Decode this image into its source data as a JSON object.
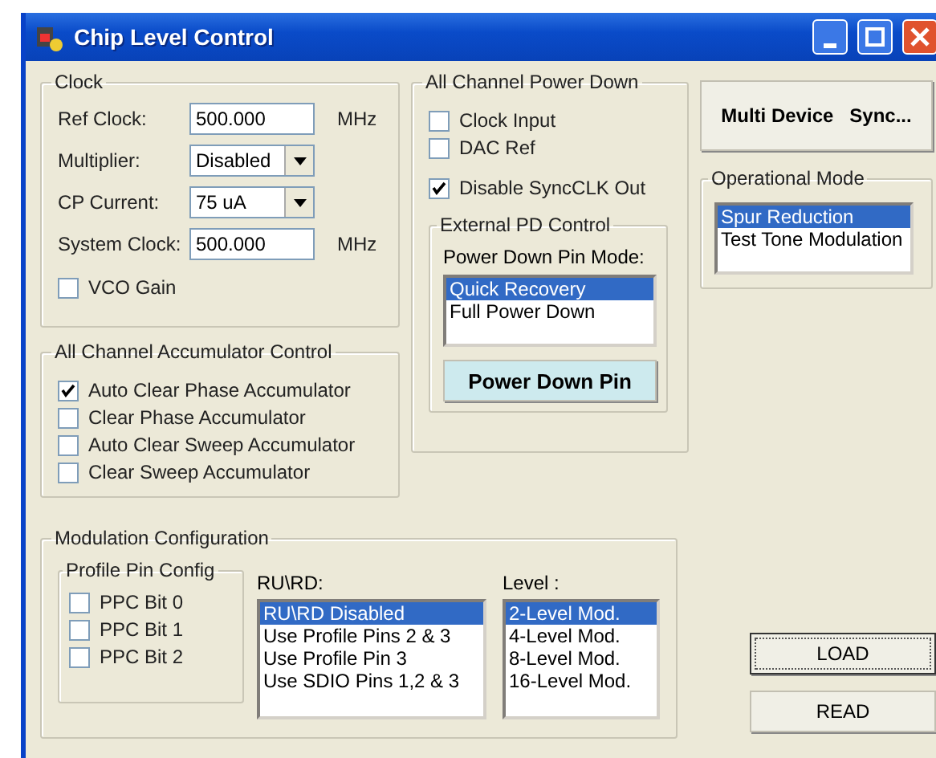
{
  "window": {
    "title": "Chip Level Control"
  },
  "clock": {
    "title": "Clock",
    "rows": [
      {
        "kind": "text",
        "label": "Ref Clock:",
        "value": "500.000",
        "unit": "MHz"
      },
      {
        "kind": "select",
        "label": "Multiplier:",
        "value": "Disabled"
      },
      {
        "kind": "select",
        "label": "CP Current:",
        "value": "75 uA"
      },
      {
        "kind": "text",
        "label": "System Clock:",
        "value": "500.000",
        "unit": "MHz"
      },
      {
        "kind": "check",
        "label": "VCO Gain",
        "checked": false
      }
    ]
  },
  "accumulator": {
    "title": "All Channel Accumulator Control",
    "options": [
      {
        "label": "Auto Clear Phase Accumulator",
        "checked": true
      },
      {
        "label": "Clear Phase Accumulator",
        "checked": false
      },
      {
        "label": "Auto Clear Sweep Accumulator",
        "checked": false
      },
      {
        "label": "Clear Sweep Accumulator",
        "checked": false
      }
    ]
  },
  "power_down": {
    "title": "All Channel Power Down",
    "options": [
      {
        "label": "Clock Input",
        "checked": false
      },
      {
        "label": "DAC Ref",
        "checked": false
      },
      {
        "label": "Disable SyncCLK Out",
        "checked": true
      }
    ],
    "external_pd": {
      "title": "External PD Control",
      "label": "Power Down Pin Mode:",
      "items": [
        {
          "label": "Quick Recovery",
          "selected": true
        },
        {
          "label": "Full Power Down",
          "selected": false
        }
      ],
      "button": "Power Down Pin"
    }
  },
  "multi_device_button": {
    "parts": [
      "Multi Device",
      "Sync..."
    ]
  },
  "operational_mode": {
    "title": "Operational Mode",
    "items": [
      {
        "label": "Spur Reduction",
        "selected": true
      },
      {
        "label": "Test Tone Modulation",
        "selected": false
      }
    ]
  },
  "modulation": {
    "title": "Modulation Configuration",
    "profile_pin_config": {
      "title": "Profile Pin Config",
      "options": [
        {
          "label": "PPC Bit 0",
          "checked": false
        },
        {
          "label": "PPC Bit 1",
          "checked": false
        },
        {
          "label": "PPC Bit 2",
          "checked": false
        }
      ]
    },
    "rurd": {
      "label": "RU\\RD:",
      "items": [
        {
          "label": "RU\\RD Disabled",
          "selected": true
        },
        {
          "label": "Use Profile Pins 2 & 3",
          "selected": false
        },
        {
          "label": "Use Profile Pin 3",
          "selected": false
        },
        {
          "label": "Use SDIO Pins 1,2 & 3",
          "selected": false
        }
      ]
    },
    "level": {
      "label": "Level :",
      "items": [
        {
          "label": "2-Level Mod.",
          "selected": true
        },
        {
          "label": "4-Level Mod.",
          "selected": false
        },
        {
          "label": "8-Level Mod.",
          "selected": false
        },
        {
          "label": "16-Level Mod.",
          "selected": false
        }
      ]
    }
  },
  "buttons": [
    {
      "label": "LOAD",
      "focused": true
    },
    {
      "label": "READ",
      "focused": false
    }
  ]
}
